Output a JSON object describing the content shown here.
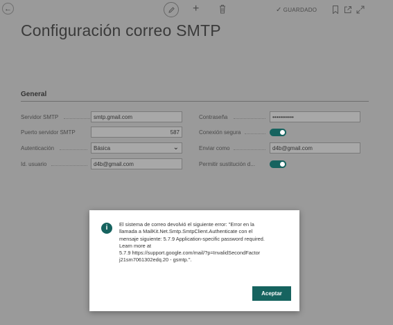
{
  "toolbar": {
    "saved_label": "GUARDADO",
    "plus_symbol": "+"
  },
  "page": {
    "title": "Configuración correo SMTP"
  },
  "section": {
    "title": "General"
  },
  "fields": {
    "smtp_server": {
      "label": "Servidor SMTP",
      "value": "smtp.gmail.com"
    },
    "smtp_port": {
      "label": "Puerto servidor SMTP",
      "value": "587"
    },
    "authentication": {
      "label": "Autenticación",
      "value": "Básica"
    },
    "user_id": {
      "label": "Id. usuario",
      "value": "d4b@gmail.com"
    },
    "password": {
      "label": "Contraseña",
      "value": "•••••••••••"
    },
    "secure_connection": {
      "label": "Conexión segura",
      "enabled": true
    },
    "send_as": {
      "label": "Enviar como",
      "value": "d4b@gmail.com"
    },
    "allow_replace": {
      "label": "Permitir sustitución d...",
      "enabled": true
    }
  },
  "dialog": {
    "icon": "info-icon",
    "message": "El sistema de correo devolvió el siguiente error: \"Error en la\nllamada a MailKit.Net.Smtp.SmtpClient.Authenticate con el\nmensaje siguiente: 5.7.9 Application-specific password required.\nLearn more at\n5.7.9 https://support.google.com/mail/?p=InvalidSecondFactor\nj21sm7061302edq.20 - gsmtp.\".",
    "accept_label": "Aceptar"
  },
  "colors": {
    "accent": "#16635f",
    "overlay_bg": "#9a9a9a"
  }
}
